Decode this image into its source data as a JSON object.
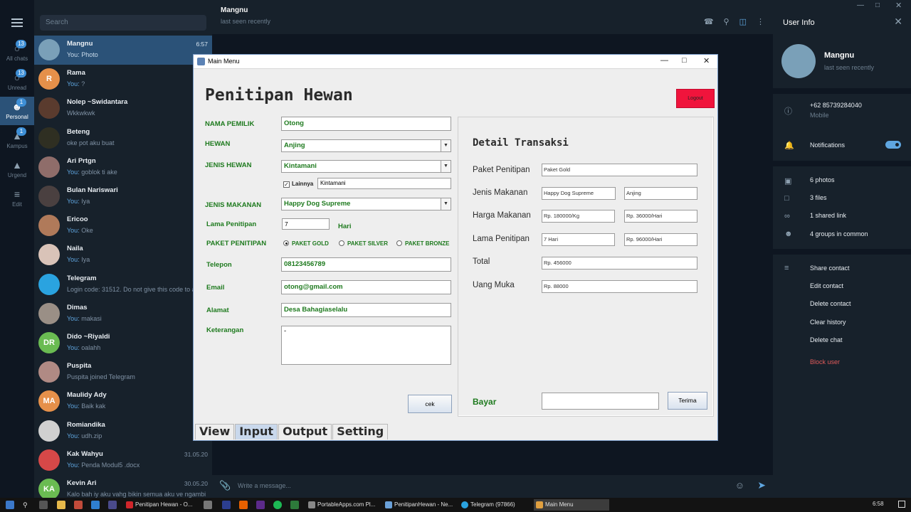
{
  "telegram": {
    "rail": [
      {
        "label": "All chats",
        "badge": "13",
        "icon": "chats-icon"
      },
      {
        "label": "Unread",
        "badge": "13",
        "icon": "unread-icon"
      },
      {
        "label": "Personal",
        "badge": "1",
        "icon": "person-icon"
      },
      {
        "label": "Kampus",
        "badge": "1",
        "icon": "graduation-cap-icon"
      },
      {
        "label": "Urgend",
        "badge": "",
        "icon": "graduation-cap-icon"
      },
      {
        "label": "Edit",
        "badge": "",
        "icon": "sliders-icon"
      }
    ],
    "search_placeholder": "Search",
    "chats": [
      {
        "name": "Mangnu",
        "preview": "Photo",
        "you": "You: ",
        "time": "6:57",
        "initials": "",
        "color": "#7aa0b8"
      },
      {
        "name": "Rama",
        "preview": "?",
        "you": "You: ",
        "time": "",
        "initials": "R",
        "color": "#e5904a"
      },
      {
        "name": "Nolep ~Swidantara",
        "preview": "Wkkwkwk",
        "you": "",
        "time": "",
        "initials": "",
        "color": "#5a3b2e"
      },
      {
        "name": "Beteng",
        "preview": "oke pot aku buat",
        "you": "",
        "time": "",
        "initials": "",
        "color": "#2f2f22"
      },
      {
        "name": "Ari Prtgn",
        "preview": "goblok ti ake",
        "you": "You: ",
        "time": "",
        "initials": "",
        "color": "#8f6d6a"
      },
      {
        "name": "Bulan Nariswari",
        "preview": "Iya",
        "you": "You: ",
        "time": "",
        "initials": "",
        "color": "#4a4040"
      },
      {
        "name": "Ericoo",
        "preview": "Oke",
        "you": "You: ",
        "time": "",
        "initials": "",
        "color": "#b07a5a"
      },
      {
        "name": "Naila",
        "preview": "Iya",
        "you": "You: ",
        "time": "",
        "initials": "",
        "color": "#d9c3b8"
      },
      {
        "name": "Telegram",
        "preview": "Login code: 31512. Do not give this code to an",
        "you": "",
        "time": "7",
        "initials": "",
        "color": "#2aa3e0"
      },
      {
        "name": "Dimas",
        "preview": "makasi",
        "you": "You: ",
        "time": "3",
        "initials": "",
        "color": "#9a8f86"
      },
      {
        "name": "Dido ~Riyaldi",
        "preview": "oalahh",
        "you": "You: ",
        "time": "3",
        "initials": "DR",
        "color": "#6abb52"
      },
      {
        "name": "Puspita",
        "preview": "Puspita joined Telegram",
        "you": "",
        "time": "2",
        "initials": "",
        "color": "#b08a84"
      },
      {
        "name": "Maulidy Ady",
        "preview": "Baik kak",
        "you": "You: ",
        "time": "1",
        "initials": "MA",
        "color": "#e5904a"
      },
      {
        "name": "Romiandika",
        "preview": "udh.zip",
        "you": "You: ",
        "time": "1",
        "initials": "",
        "color": "#d0d0d0"
      },
      {
        "name": "Kak Wahyu",
        "preview": "Penda Modul5 .docx",
        "you": "You: ",
        "time": "31.05.20",
        "initials": "",
        "color": "#d64848"
      },
      {
        "name": "Kevin Ari",
        "preview": "Kalo bah iy aku vahg bikin semua aku ve ngambi",
        "you": "",
        "time": "30.05.20",
        "initials": "KA",
        "color": "#6abb52"
      }
    ],
    "header": {
      "name": "Mangnu",
      "status": "last seen recently"
    },
    "composer_placeholder": "Write a message...",
    "info": {
      "title": "User Info",
      "name": "Mangnu",
      "status": "last seen recently",
      "phone": "+62 85739284040",
      "phone_label": "Mobile",
      "notifications": "Notifications",
      "photos": "6 photos",
      "files": "3 files",
      "links": "1 shared link",
      "groups": "4 groups in common",
      "share": "Share contact",
      "edit": "Edit contact",
      "delete_contact": "Delete contact",
      "clear": "Clear history",
      "delete_chat": "Delete chat",
      "block": "Block user"
    }
  },
  "taskbar": {
    "items": [
      {
        "label": "Penitipan Hewan - O..."
      },
      {
        "label": "PortableApps.com Pl..."
      },
      {
        "label": "PenitipanHewan - Ne..."
      },
      {
        "label": "Telegram (97866)"
      },
      {
        "label": "Main Menu"
      }
    ],
    "time": "6:58"
  },
  "window": {
    "title": "Main Menu",
    "heading": "Penitipan Hewan",
    "logout": "Logout",
    "form": {
      "nama_label": "NAMA PEMILIK",
      "nama": "Otong",
      "hewan_label": "HEWAN",
      "hewan": "Anjing",
      "jenis_label": "JENIS HEWAN",
      "jenis": "Kintamani",
      "lainnya_label": "Lainnya",
      "lainnya": "Kintamani",
      "makanan_label": "JENIS MAKANAN",
      "makanan": "Happy Dog Supreme",
      "lama_label": "Lama Penitipan",
      "lama": "7",
      "hari": "Hari",
      "paket_label": "PAKET PENITIPAN",
      "paket_gold": "PAKET GOLD",
      "paket_silver": "PAKET SILVER",
      "paket_bronze": "PAKET BRONZE",
      "telepon_label": "Telepon",
      "telepon": "08123456789",
      "email_label": "Email",
      "email": "otong@gmail.com",
      "alamat_label": "Alamat",
      "alamat": "Desa Bahagiaselalu",
      "ket_label": "Keterangan",
      "ket": "-",
      "cek": "cek"
    },
    "detail": {
      "title": "Detail Transaksi",
      "paket_label": "Paket Penitipan",
      "paket": "Paket Gold",
      "makanan_label": "Jenis Makanan",
      "makanan": "Happy Dog Supreme",
      "hewan": "Anjing",
      "harga_label": "Harga Makanan",
      "harga1": "Rp. 180000/Kg",
      "harga2": "Rp. 36000/Hari",
      "lama_label": "Lama Penitipan",
      "lama1": "7 Hari",
      "lama2": "Rp. 96000/Hari",
      "total_label": "Total",
      "total": "Rp. 456000",
      "uang_label": "Uang Muka",
      "uang": "Rp. 88000",
      "bayar_label": "Bayar",
      "bayar": "",
      "terima": "Terima"
    },
    "tabs": [
      "View",
      "Input",
      "Output",
      "Setting"
    ],
    "active_tab": "Input"
  }
}
